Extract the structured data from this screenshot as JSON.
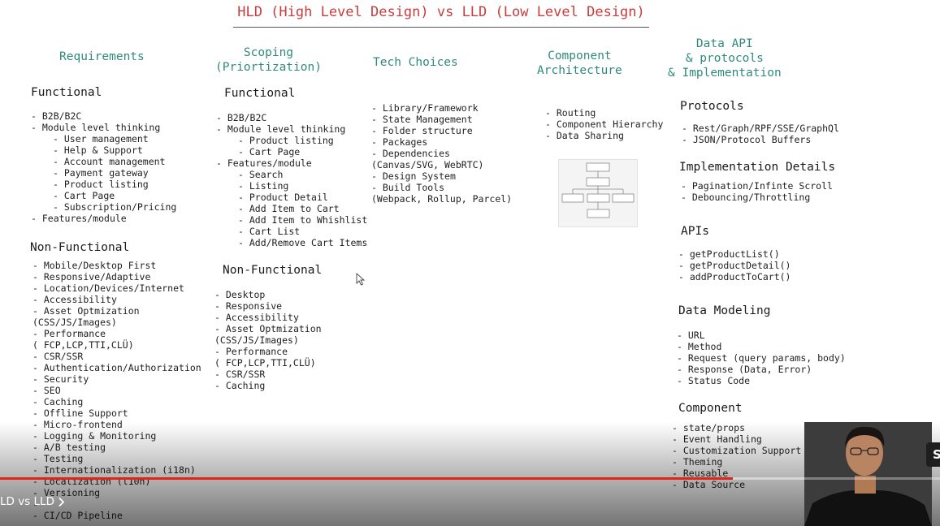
{
  "title": "HLD (High Level Design) vs LLD (Low Level Design)",
  "columns": {
    "requirements": {
      "heading": "Requirements",
      "functional_heading": "Functional",
      "functional": [
        {
          "t": "B2B/B2C",
          "lvl": 1
        },
        {
          "t": "Module level thinking",
          "lvl": 1
        },
        {
          "t": "User management",
          "lvl": 2
        },
        {
          "t": "Help & Support",
          "lvl": 2
        },
        {
          "t": "Account management",
          "lvl": 2
        },
        {
          "t": "Payment gateway",
          "lvl": 2
        },
        {
          "t": "Product listing",
          "lvl": 2
        },
        {
          "t": "Cart Page",
          "lvl": 2
        },
        {
          "t": "Subscription/Pricing",
          "lvl": 2
        },
        {
          "t": "Features/module",
          "lvl": 1
        }
      ],
      "nonfunctional_heading": "Non-Functional",
      "nonfunctional": [
        {
          "t": "Mobile/Desktop First",
          "lvl": 1
        },
        {
          "t": "Responsive/Adaptive",
          "lvl": 1
        },
        {
          "t": "Location/Devices/Internet",
          "lvl": 1
        },
        {
          "t": "Accessibility",
          "lvl": 1
        },
        {
          "t": "Asset Optmization",
          "lvl": 1
        },
        {
          "t": "(CSS/JS/Images)",
          "lvl": 0
        },
        {
          "t": "Performance",
          "lvl": 1
        },
        {
          "t": "( FCP,LCP,TTI,CLÜ)",
          "lvl": 0
        },
        {
          "t": "CSR/SSR",
          "lvl": 1
        },
        {
          "t": "Authentication/Authorization",
          "lvl": 1
        },
        {
          "t": "Security",
          "lvl": 1
        },
        {
          "t": "SEO",
          "lvl": 1
        },
        {
          "t": "Caching",
          "lvl": 1
        },
        {
          "t": "Offline Support",
          "lvl": 1
        },
        {
          "t": "Micro-frontend",
          "lvl": 1
        },
        {
          "t": "Logging & Monitoring",
          "lvl": 1
        },
        {
          "t": "A/B testing",
          "lvl": 1
        },
        {
          "t": "Testing",
          "lvl": 1
        },
        {
          "t": "Internationalization (i18n)",
          "lvl": 1
        },
        {
          "t": "Localization (l10n)",
          "lvl": 1
        },
        {
          "t": "Versioning",
          "lvl": 1
        },
        {
          "t": "",
          "lvl": 1
        },
        {
          "t": "CI/CD Pipeline",
          "lvl": 1
        }
      ]
    },
    "scoping": {
      "heading": "Scoping\n(Priortization)",
      "functional_heading": "Functional",
      "functional": [
        {
          "t": "B2B/B2C",
          "lvl": 1
        },
        {
          "t": "Module level thinking",
          "lvl": 1
        },
        {
          "t": "Product listing",
          "lvl": 2
        },
        {
          "t": "Cart Page",
          "lvl": 2
        },
        {
          "t": "Features/module",
          "lvl": 1
        },
        {
          "t": "Search",
          "lvl": 2
        },
        {
          "t": "Listing",
          "lvl": 2
        },
        {
          "t": "Product Detail",
          "lvl": 2
        },
        {
          "t": "Add Item to Cart",
          "lvl": 2
        },
        {
          "t": "Add Item to Whishlist",
          "lvl": 2
        },
        {
          "t": "Cart List",
          "lvl": 2
        },
        {
          "t": "Add/Remove Cart Items",
          "lvl": 2
        }
      ],
      "nonfunctional_heading": "Non-Functional",
      "nonfunctional": [
        {
          "t": "Desktop",
          "lvl": 1
        },
        {
          "t": "Responsive",
          "lvl": 1
        },
        {
          "t": "Accessibility",
          "lvl": 1
        },
        {
          "t": "Asset Optmization",
          "lvl": 1
        },
        {
          "t": "(CSS/JS/Images)",
          "lvl": 0
        },
        {
          "t": "Performance",
          "lvl": 1
        },
        {
          "t": "( FCP,LCP,TTI,CLÜ)",
          "lvl": 0
        },
        {
          "t": "CSR/SSR",
          "lvl": 1
        },
        {
          "t": "Caching",
          "lvl": 1
        }
      ]
    },
    "tech": {
      "heading": "Tech Choices",
      "items": [
        {
          "t": "Library/Framework",
          "lvl": 1
        },
        {
          "t": "State Management",
          "lvl": 1
        },
        {
          "t": "Folder structure",
          "lvl": 1
        },
        {
          "t": "Packages",
          "lvl": 1
        },
        {
          "t": "Dependencies",
          "lvl": 1
        },
        {
          "t": "  (Canvas/SVG, WebRTC)",
          "lvl": 0
        },
        {
          "t": "Design System",
          "lvl": 1
        },
        {
          "t": "Build Tools",
          "lvl": 1
        },
        {
          "t": "(Webpack, Rollup, Parcel)",
          "lvl": 0
        }
      ]
    },
    "component": {
      "heading": "Component\nArchitecture",
      "items": [
        {
          "t": "Routing",
          "lvl": 1
        },
        {
          "t": "Component Hierarchy",
          "lvl": 1
        },
        {
          "t": "Data Sharing",
          "lvl": 1
        }
      ]
    },
    "dataapi": {
      "heading": "Data API\n& protocols\n& Implementation",
      "protocols_heading": "Protocols",
      "protocols": [
        {
          "t": "Rest/Graph/RPF/SSE/GraphQl",
          "lvl": 1
        },
        {
          "t": "JSON/Protocol Buffers",
          "lvl": 1
        }
      ],
      "impl_heading": "Implementation Details",
      "impl": [
        {
          "t": "Pagination/Infinte Scroll",
          "lvl": 1
        },
        {
          "t": "Debouncing/Throttling",
          "lvl": 1
        }
      ],
      "apis_heading": "APIs",
      "apis": [
        {
          "t": "getProductList()",
          "lvl": 1
        },
        {
          "t": "getProductDetail()",
          "lvl": 1
        },
        {
          "t": "addProductToCart()",
          "lvl": 1
        }
      ],
      "modeling_heading": "Data Modeling",
      "modeling": [
        {
          "t": "URL",
          "lvl": 1
        },
        {
          "t": "Method",
          "lvl": 1
        },
        {
          "t": "Request (query params, body)",
          "lvl": 1
        },
        {
          "t": "Response (Data, Error)",
          "lvl": 1
        },
        {
          "t": "Status Code",
          "lvl": 1
        }
      ],
      "component_heading": "Component",
      "component": [
        {
          "t": "state/props",
          "lvl": 1
        },
        {
          "t": "Event Handling",
          "lvl": 1
        },
        {
          "t": "Customization Support",
          "lvl": 1
        },
        {
          "t": "Theming",
          "lvl": 1
        },
        {
          "t": "Reusable",
          "lvl": 1
        },
        {
          "t": "Data Source",
          "lvl": 1
        }
      ]
    }
  },
  "player": {
    "chapter_label": "LD vs LLD",
    "chapter_chevron": "chevron-right-icon",
    "side_button_label": "S",
    "progress_fraction": 0.78,
    "progress_color": "#e62117"
  },
  "colors": {
    "title": "#c93c3c",
    "heading": "#2f8a7c"
  }
}
